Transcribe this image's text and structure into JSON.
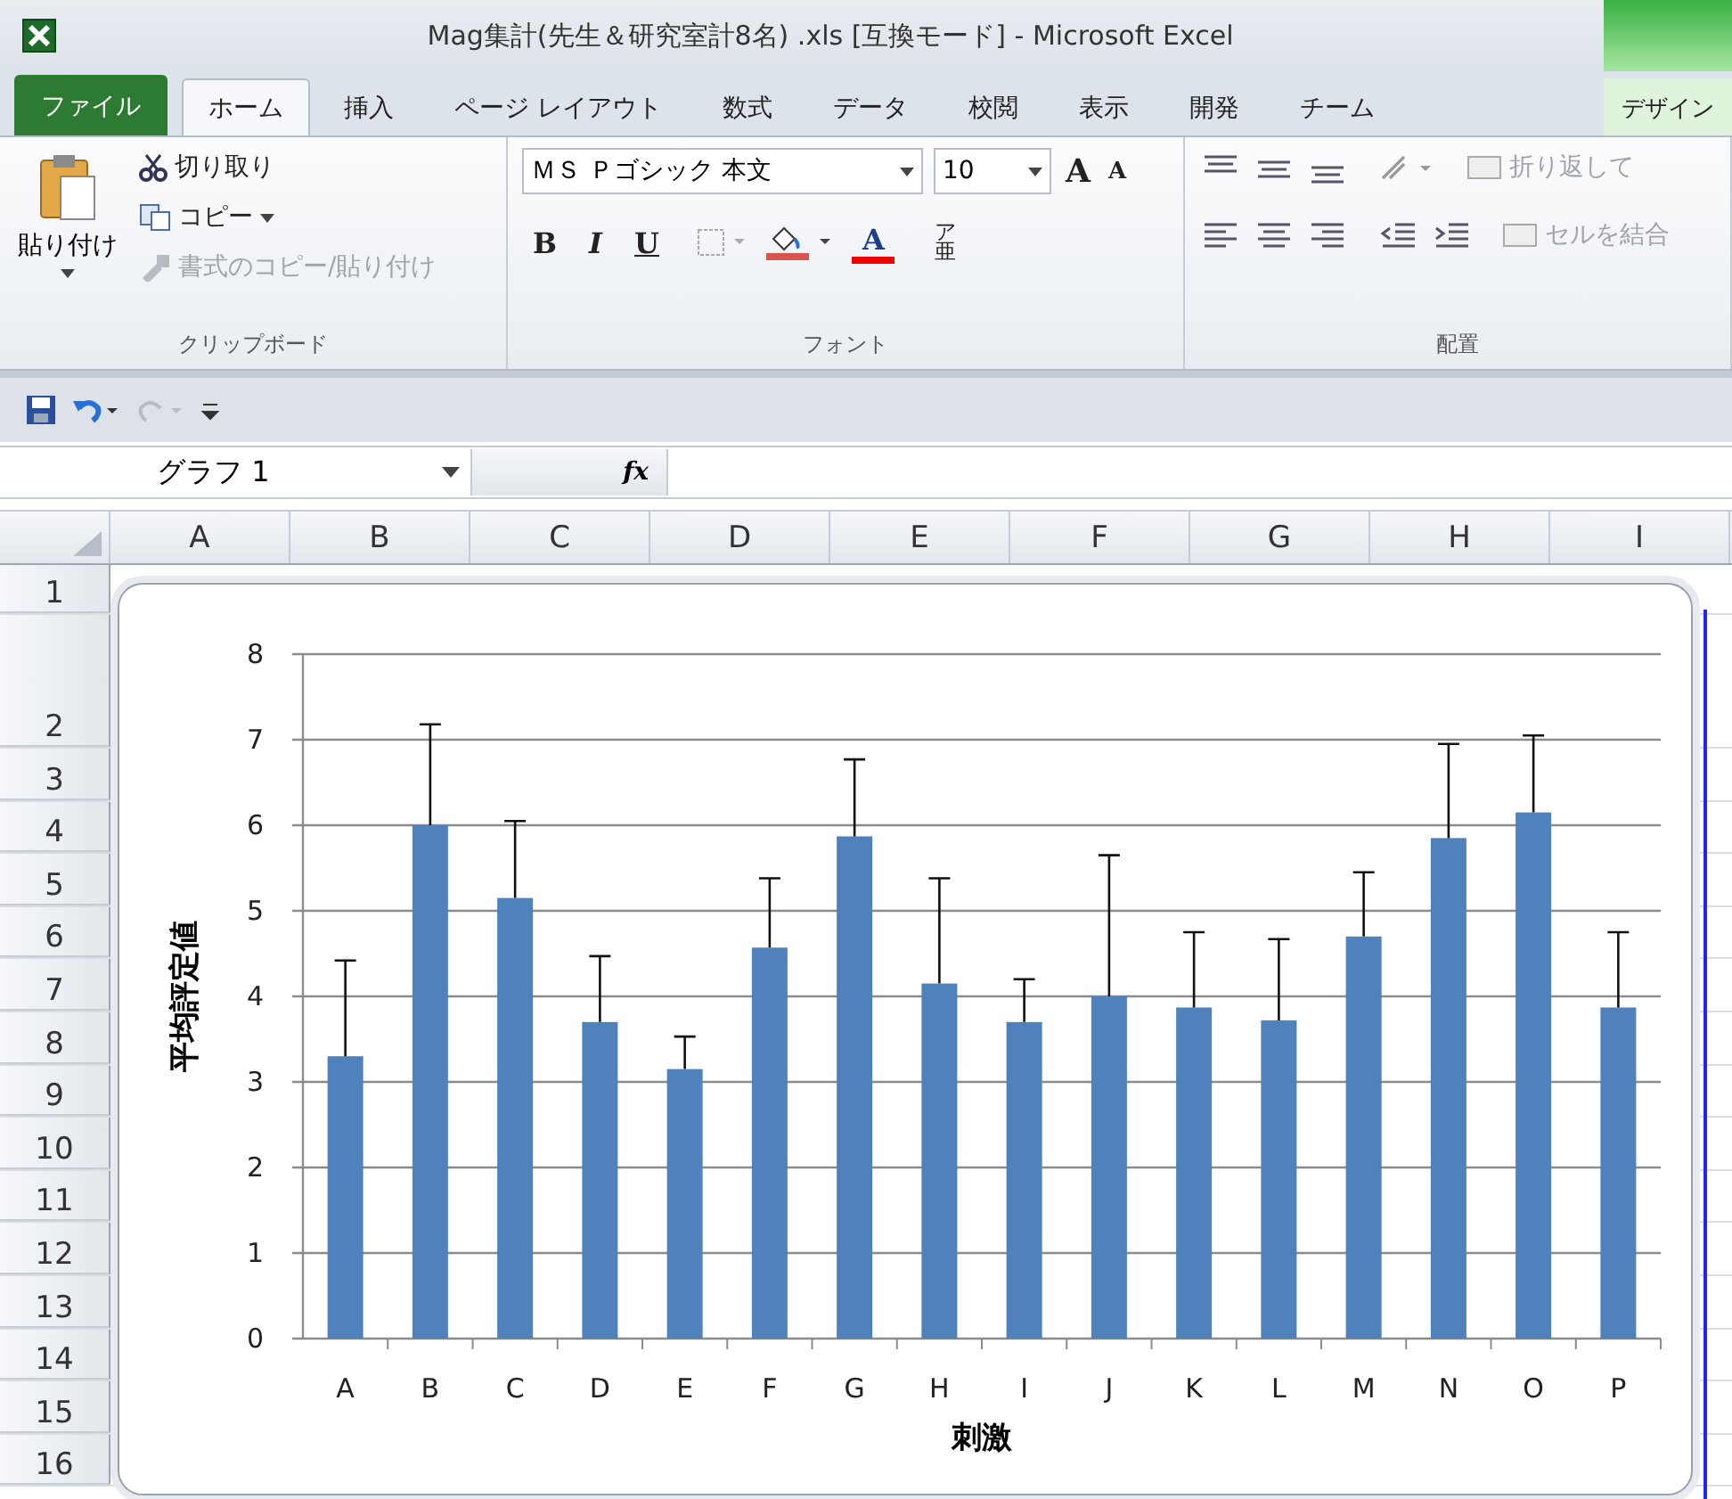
{
  "window": {
    "title": "Mag集計(先生＆研究室計8名) .xls  [互換モード]  -  Microsoft Excel"
  },
  "tabs": [
    {
      "label": "ファイル",
      "kind": "file",
      "selected": false
    },
    {
      "label": "ホーム",
      "kind": "normal",
      "selected": true
    },
    {
      "label": "挿入",
      "kind": "normal",
      "selected": false
    },
    {
      "label": "ページ レイアウト",
      "kind": "normal",
      "selected": false
    },
    {
      "label": "数式",
      "kind": "normal",
      "selected": false
    },
    {
      "label": "データ",
      "kind": "normal",
      "selected": false
    },
    {
      "label": "校閲",
      "kind": "normal",
      "selected": false
    },
    {
      "label": "表示",
      "kind": "normal",
      "selected": false
    },
    {
      "label": "開発",
      "kind": "normal",
      "selected": false
    },
    {
      "label": "チーム",
      "kind": "normal",
      "selected": false
    },
    {
      "label": "デザイン",
      "kind": "contextual",
      "selected": false
    }
  ],
  "clipboard": {
    "paste": "貼り付け",
    "cut": "切り取り",
    "copy": "コピー",
    "format_painter": {
      "label": "書式のコピー/貼り付け",
      "disabled": true
    },
    "label": "クリップボード"
  },
  "font": {
    "font_name": "ＭＳ Ｐゴシック 本文",
    "font_size": "10",
    "grow": "A",
    "shrink": "A",
    "bold": "B",
    "italic": "I",
    "underline": "U",
    "font_color": "A",
    "phonetic_ruby": "ア",
    "phonetic": "亜",
    "label": "フォント"
  },
  "alignment": {
    "wrap_text": {
      "label": "折り返して",
      "disabled": true
    },
    "merge": {
      "label": "セルを結合",
      "disabled": true
    },
    "label": "配置"
  },
  "quick_access": {
    "redo_disabled": true
  },
  "name_box": "グラフ 1",
  "function_button": "fx",
  "columns": [
    "A",
    "B",
    "C",
    "D",
    "E",
    "F",
    "G",
    "H",
    "I"
  ],
  "rows": [
    "1",
    "2",
    "3",
    "4",
    "5",
    "6",
    "7",
    "8",
    "9",
    "10",
    "11",
    "12",
    "13",
    "14",
    "15",
    "16"
  ],
  "chart": {
    "chart_data": {
      "type": "bar",
      "xlabel": "刺激",
      "ylabel": "平均評定値",
      "categories": [
        "A",
        "B",
        "C",
        "D",
        "E",
        "F",
        "G",
        "H",
        "I",
        "J",
        "K",
        "L",
        "M",
        "N",
        "O",
        "P"
      ],
      "series": [
        {
          "color": "#4f81bd",
          "values": [
            3.3,
            6.0,
            5.15,
            3.7,
            3.15,
            4.57,
            5.87,
            4.15,
            3.7,
            4.0,
            3.87,
            3.72,
            4.7,
            5.85,
            6.15,
            3.87
          ],
          "errors": [
            1.12,
            1.18,
            0.9,
            0.77,
            0.38,
            0.81,
            0.9,
            1.23,
            0.5,
            1.65,
            0.88,
            0.95,
            0.75,
            1.1,
            0.9,
            0.88
          ]
        }
      ],
      "ylim": [
        0,
        8
      ],
      "yticks": [
        0,
        1,
        2,
        3,
        4,
        5,
        6,
        7,
        8
      ],
      "grid": true
    }
  }
}
